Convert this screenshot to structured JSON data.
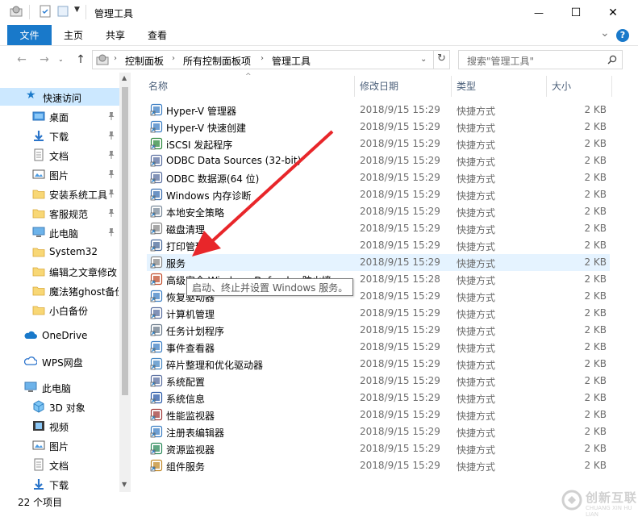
{
  "window": {
    "title": "管理工具",
    "minimize": "—",
    "maximize": "☐",
    "close": "✕"
  },
  "ribbon": {
    "tabs": [
      "文件",
      "主页",
      "共享",
      "查看"
    ],
    "expand": "⌄",
    "help": "?"
  },
  "address": {
    "crumbs": [
      "控制面板",
      "所有控制面板项",
      "管理工具"
    ],
    "search_placeholder": "搜索\"管理工具\""
  },
  "nav": {
    "quick_access": "快速访问",
    "pinned": [
      {
        "label": "桌面",
        "icon": "desktop-folder-icon",
        "pinned": true
      },
      {
        "label": "下载",
        "icon": "downloads-folder-icon",
        "pinned": true
      },
      {
        "label": "文档",
        "icon": "documents-folder-icon",
        "pinned": true
      },
      {
        "label": "图片",
        "icon": "pictures-folder-icon",
        "pinned": true
      },
      {
        "label": "安装系统工具",
        "icon": "folder-icon",
        "pinned": true
      },
      {
        "label": "客服规范",
        "icon": "folder-icon",
        "pinned": true
      },
      {
        "label": "此电脑",
        "icon": "computer-icon",
        "pinned": true
      },
      {
        "label": "System32",
        "icon": "folder-icon",
        "pinned": false
      },
      {
        "label": "编辑之文章修改",
        "icon": "folder-icon",
        "pinned": false
      },
      {
        "label": "魔法猪ghost备份",
        "icon": "folder-icon",
        "pinned": false
      },
      {
        "label": "小白备份",
        "icon": "folder-icon",
        "pinned": false
      }
    ],
    "onedrive": "OneDrive",
    "wps": "WPS网盘",
    "this_pc": "此电脑",
    "pc_items": [
      {
        "label": "3D 对象",
        "icon": "3d-objects-icon"
      },
      {
        "label": "视频",
        "icon": "videos-icon"
      },
      {
        "label": "图片",
        "icon": "pictures-folder-icon"
      },
      {
        "label": "文档",
        "icon": "documents-folder-icon"
      },
      {
        "label": "下载",
        "icon": "downloads-folder-icon"
      }
    ]
  },
  "columns": {
    "name": "名称",
    "date": "修改日期",
    "type": "类型",
    "size": "大小"
  },
  "files": [
    {
      "name": "Hyper-V 管理器",
      "date": "2018/9/15 15:29",
      "type": "快捷方式",
      "size": "2 KB"
    },
    {
      "name": "Hyper-V 快速创建",
      "date": "2018/9/15 15:29",
      "type": "快捷方式",
      "size": "2 KB"
    },
    {
      "name": "iSCSI 发起程序",
      "date": "2018/9/15 15:29",
      "type": "快捷方式",
      "size": "2 KB"
    },
    {
      "name": "ODBC Data Sources (32-bit)",
      "date": "2018/9/15 15:29",
      "type": "快捷方式",
      "size": "2 KB"
    },
    {
      "name": "ODBC 数据源(64 位)",
      "date": "2018/9/15 15:29",
      "type": "快捷方式",
      "size": "2 KB"
    },
    {
      "name": "Windows 内存诊断",
      "date": "2018/9/15 15:29",
      "type": "快捷方式",
      "size": "2 KB"
    },
    {
      "name": "本地安全策略",
      "date": "2018/9/15 15:29",
      "type": "快捷方式",
      "size": "2 KB"
    },
    {
      "name": "磁盘清理",
      "date": "2018/9/15 15:29",
      "type": "快捷方式",
      "size": "2 KB"
    },
    {
      "name": "打印管理",
      "date": "2018/9/15 15:29",
      "type": "快捷方式",
      "size": "2 KB"
    },
    {
      "name": "服务",
      "date": "2018/9/15 15:29",
      "type": "快捷方式",
      "size": "2 KB"
    },
    {
      "name": "高级安全 Windows Defender 防火墙",
      "date": "2018/9/15 15:28",
      "type": "快捷方式",
      "size": "2 KB"
    },
    {
      "name": "恢复驱动器",
      "date": "2018/9/15 15:29",
      "type": "快捷方式",
      "size": "2 KB"
    },
    {
      "name": "计算机管理",
      "date": "2018/9/15 15:29",
      "type": "快捷方式",
      "size": "2 KB"
    },
    {
      "name": "任务计划程序",
      "date": "2018/9/15 15:29",
      "type": "快捷方式",
      "size": "2 KB"
    },
    {
      "name": "事件查看器",
      "date": "2018/9/15 15:29",
      "type": "快捷方式",
      "size": "2 KB"
    },
    {
      "name": "碎片整理和优化驱动器",
      "date": "2018/9/15 15:29",
      "type": "快捷方式",
      "size": "2 KB"
    },
    {
      "name": "系统配置",
      "date": "2018/9/15 15:29",
      "type": "快捷方式",
      "size": "2 KB"
    },
    {
      "name": "系统信息",
      "date": "2018/9/15 15:29",
      "type": "快捷方式",
      "size": "2 KB"
    },
    {
      "name": "性能监视器",
      "date": "2018/9/15 15:29",
      "type": "快捷方式",
      "size": "2 KB"
    },
    {
      "name": "注册表编辑器",
      "date": "2018/9/15 15:29",
      "type": "快捷方式",
      "size": "2 KB"
    },
    {
      "name": "资源监视器",
      "date": "2018/9/15 15:29",
      "type": "快捷方式",
      "size": "2 KB"
    },
    {
      "name": "组件服务",
      "date": "2018/9/15 15:29",
      "type": "快捷方式",
      "size": "2 KB"
    }
  ],
  "hovered_file": "服务",
  "tooltip": "启动、终止并设置 Windows 服务。",
  "status": {
    "count": "22 个项目"
  },
  "watermark": {
    "text": "创新互联",
    "sub": "CHUANG XIN HU LIAN"
  },
  "colors": {
    "accent": "#1979ca",
    "selection": "#cce8ff",
    "hover": "#e5f3ff",
    "annotation_arrow": "#e8262a"
  }
}
